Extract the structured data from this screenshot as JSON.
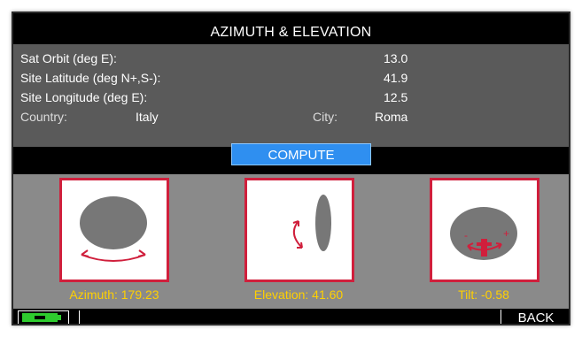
{
  "window": {
    "title": "AZIMUTH & ELEVATION"
  },
  "info": {
    "sat_orbit_label": "Sat Orbit (deg E):",
    "sat_orbit_value": "13.0",
    "site_latitude_label": "Site Latitude (deg N+,S-):",
    "site_latitude_value": "41.9",
    "site_longitude_label": "Site Longitude (deg E):",
    "site_longitude_value": "12.5",
    "country_label": "Country:",
    "country_value": "Italy",
    "city_label": "City:",
    "city_value": "Roma"
  },
  "actions": {
    "compute_label": "COMPUTE",
    "back_label": "BACK"
  },
  "results": {
    "azimuth": "Azimuth: 179.23",
    "elevation": "Elevation: 41.60",
    "tilt": "Tilt: -0.58"
  },
  "tilt_marks": {
    "minus": "-",
    "plus": "+"
  },
  "colors": {
    "panel_gray": "#5a5a5a",
    "diagram_gray": "#8a8a8a",
    "card_border_red": "#d01f3c",
    "caption_yellow": "#ffd000",
    "button_blue": "#2f8ff0",
    "battery_green": "#2ecc2e"
  },
  "icons": {
    "battery": "battery-icon"
  }
}
